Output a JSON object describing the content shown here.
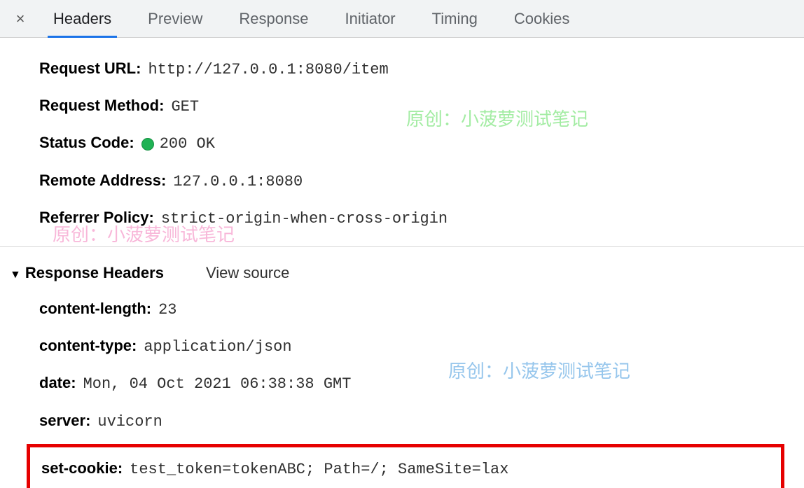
{
  "tabs": {
    "headers": "Headers",
    "preview": "Preview",
    "response": "Response",
    "initiator": "Initiator",
    "timing": "Timing",
    "cookies": "Cookies"
  },
  "general": {
    "request_url_label": "Request URL:",
    "request_url_value": "http://127.0.0.1:8080/item",
    "request_method_label": "Request Method:",
    "request_method_value": "GET",
    "status_code_label": "Status Code:",
    "status_code_value": "200 OK",
    "remote_address_label": "Remote Address:",
    "remote_address_value": "127.0.0.1:8080",
    "referrer_policy_label": "Referrer Policy:",
    "referrer_policy_value": "strict-origin-when-cross-origin"
  },
  "response_section": {
    "title": "Response Headers",
    "view_source": "View source"
  },
  "response_headers": {
    "content_length_label": "content-length:",
    "content_length_value": "23",
    "content_type_label": "content-type:",
    "content_type_value": "application/json",
    "date_label": "date:",
    "date_value": "Mon, 04 Oct 2021 06:38:38 GMT",
    "server_label": "server:",
    "server_value": "uvicorn",
    "set_cookie_label": "set-cookie:",
    "set_cookie_value": "test_token=tokenABC; Path=/; SameSite=lax"
  },
  "watermarks": {
    "text": "原创：小菠萝测试笔记"
  }
}
